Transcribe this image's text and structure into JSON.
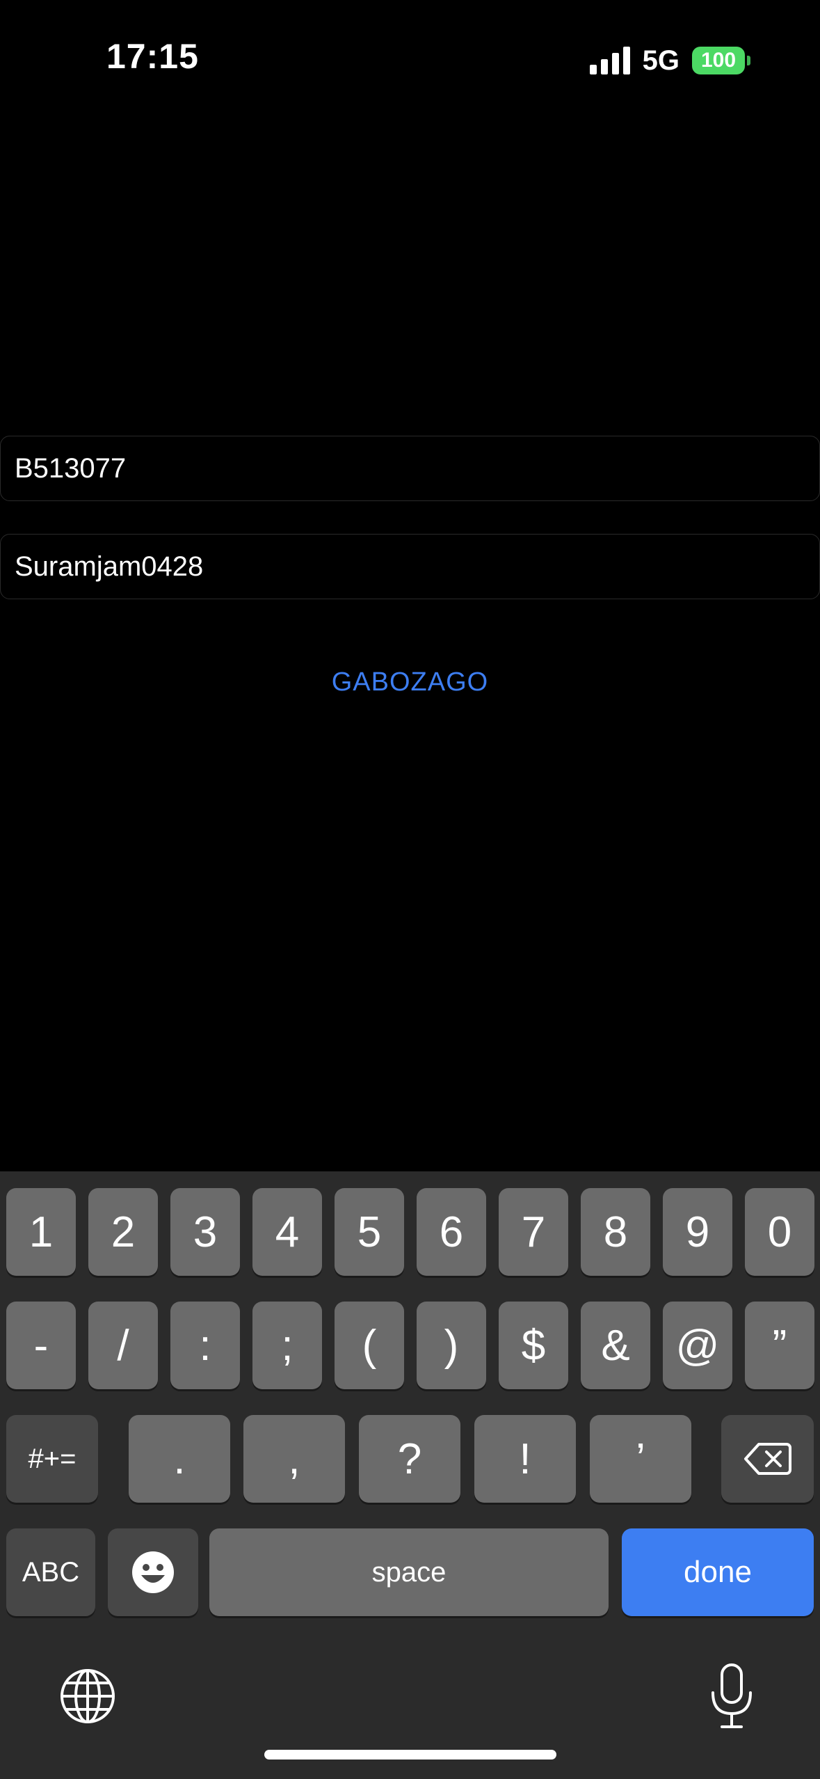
{
  "status_bar": {
    "time": "17:15",
    "network": "5G",
    "battery": "100",
    "battery_color": "#4cd964"
  },
  "form": {
    "username_value": "B513077",
    "password_value": "Suramjam0428",
    "submit_label": "GABOZAGO",
    "accent_color": "#3d7ef2"
  },
  "keyboard": {
    "row1": [
      "1",
      "2",
      "3",
      "4",
      "5",
      "6",
      "7",
      "8",
      "9",
      "0"
    ],
    "row2": [
      "-",
      "/",
      ":",
      ";",
      "(",
      ")",
      "$",
      "&",
      "@",
      "”"
    ],
    "row3_symbols_label": "#+=",
    "row3": [
      ".",
      ",",
      "?",
      "!",
      "’"
    ],
    "abc_label": "ABC",
    "space_label": "space",
    "done_label": "done",
    "icons": [
      "delete-icon",
      "emoji-icon",
      "globe-icon",
      "microphone-icon"
    ]
  }
}
